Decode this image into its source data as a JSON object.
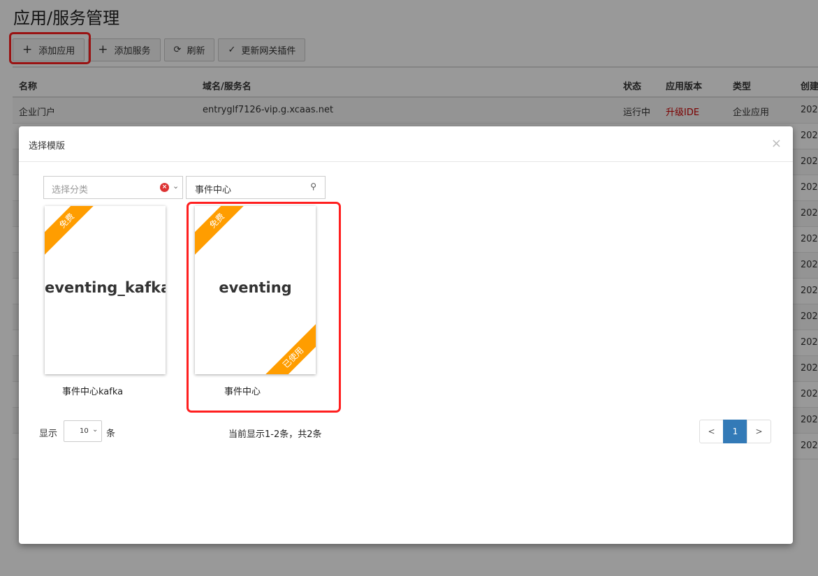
{
  "page": {
    "title": "应用/服务管理",
    "toolbar": {
      "add_app": "添加应用",
      "add_service": "添加服务",
      "refresh": "刷新",
      "update_plugin": "更新网关插件"
    },
    "table": {
      "headers": {
        "name": "名称",
        "domain": "域名/服务名",
        "status": "状态",
        "version": "应用版本",
        "type": "类型",
        "created": "创建"
      },
      "first_row": {
        "name": "企业门户",
        "domain": "entryglf7126-vip.g.xcaas.net",
        "status": "运行中",
        "version": "升级IDE",
        "type": "企业应用",
        "created": "202"
      },
      "created_column_rest": [
        "202",
        "202",
        "202",
        "202",
        "202",
        "202",
        "202",
        "202",
        "202",
        "202",
        "202",
        "202",
        "202"
      ]
    }
  },
  "modal": {
    "title": "选择模版",
    "close": "×",
    "filter": {
      "category_placeholder": "选择分类",
      "search_value": "事件中心"
    },
    "cards": [
      {
        "name": "eventing_kafka",
        "badge": "免费",
        "caption": "事件中心kafka",
        "used_badge": ""
      },
      {
        "name": "eventing",
        "badge": "免费",
        "caption": "事件中心",
        "used_badge": "已使用"
      }
    ],
    "pagination": {
      "show_label": "显示",
      "page_size": "10",
      "unit_label": "条",
      "info": "当前显示1-2条，共2条",
      "prev": "<",
      "current": "1",
      "next": ">"
    }
  },
  "colors": {
    "highlight_red": "#ff1f1f",
    "ribbon_orange": "#ff9d00",
    "pager_active": "#337ab7",
    "version_red": "#cc0000"
  }
}
